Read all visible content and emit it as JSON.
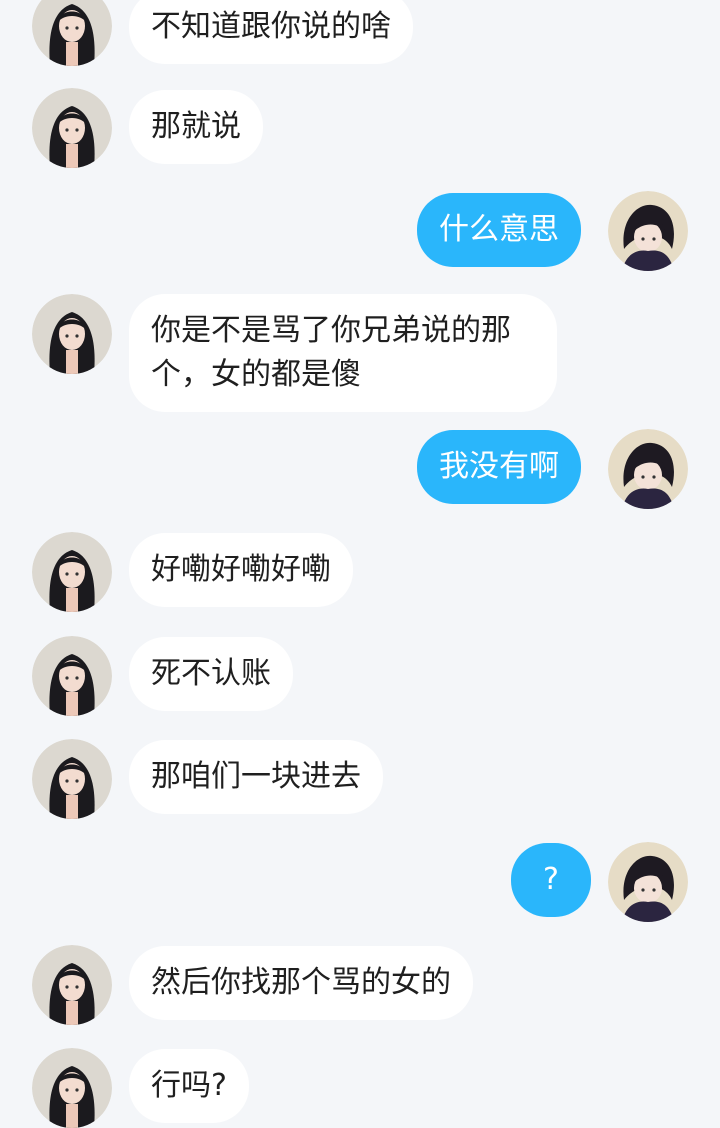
{
  "theme": {
    "background": "#f4f6f9",
    "incoming_bubble": "#ffffff",
    "outgoing_bubble": "#2ab6fb",
    "incoming_text": "#1f1f1f",
    "outgoing_text": "#ffffff"
  },
  "avatars": {
    "incoming": "girl-avatar-icon",
    "outgoing": "boy-avatar-icon"
  },
  "messages": [
    {
      "side": "left",
      "text": "不知道跟你说的啥"
    },
    {
      "side": "left",
      "text": "那就说"
    },
    {
      "side": "right",
      "text": "什么意思"
    },
    {
      "side": "left",
      "text": "你是不是骂了你兄弟说的那个，女的都是傻"
    },
    {
      "side": "right",
      "text": "我没有啊"
    },
    {
      "side": "left",
      "text": "好嘞好嘞好嘞"
    },
    {
      "side": "left",
      "text": "死不认账"
    },
    {
      "side": "left",
      "text": "那咱们一块进去"
    },
    {
      "side": "right",
      "text": "?"
    },
    {
      "side": "left",
      "text": "然后你找那个骂的女的"
    },
    {
      "side": "left",
      "text": "行吗?"
    }
  ]
}
